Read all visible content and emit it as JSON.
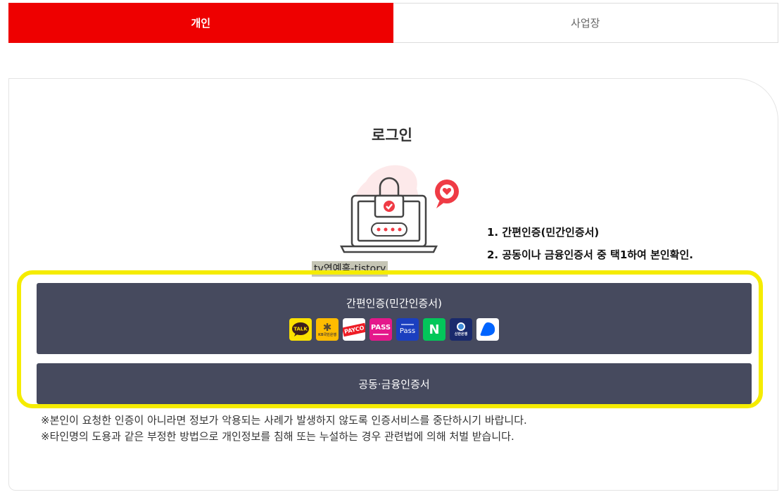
{
  "tabs": {
    "personal": "개인",
    "business": "사업장"
  },
  "login": {
    "title": "로그인"
  },
  "steps": {
    "step1": "1. 간편인증(민간인증서)",
    "step2": "2. 공동이나 금융인증서 중 택1하여 본인확인."
  },
  "watermark": "tv연예홈-tistory",
  "buttons": {
    "simple_auth": "간편인증(민간인증서)",
    "cert_auth": "공동·금융인증서"
  },
  "auth_icons": [
    {
      "name": "kakao-talk-icon",
      "text": "TALK"
    },
    {
      "name": "kb-bank-icon",
      "text": "KB국민은행"
    },
    {
      "name": "payco-icon",
      "text": "PAYCO"
    },
    {
      "name": "pass-icon",
      "text": "PASS"
    },
    {
      "name": "samsung-pass-icon",
      "text": "Pass"
    },
    {
      "name": "naver-icon",
      "text": "N"
    },
    {
      "name": "shinhan-bank-icon",
      "text": "신한은행"
    },
    {
      "name": "toss-icon",
      "text": ""
    }
  ],
  "notice": {
    "line1": "※본인이 요청한 인증이 아니라면 정보가 악용되는 사례가 발생하지 않도록 인증서비스를 중단하시기 바랍니다.",
    "line2": "※타인명의 도용과 같은 부정한 방법으로 개인정보를 침해 또는 누설하는 경우 관련법에 의해 처벌 받습니다."
  },
  "colors": {
    "accent": "#ee0000",
    "button_bg": "#464a5e",
    "highlight": "#f5ec00"
  }
}
